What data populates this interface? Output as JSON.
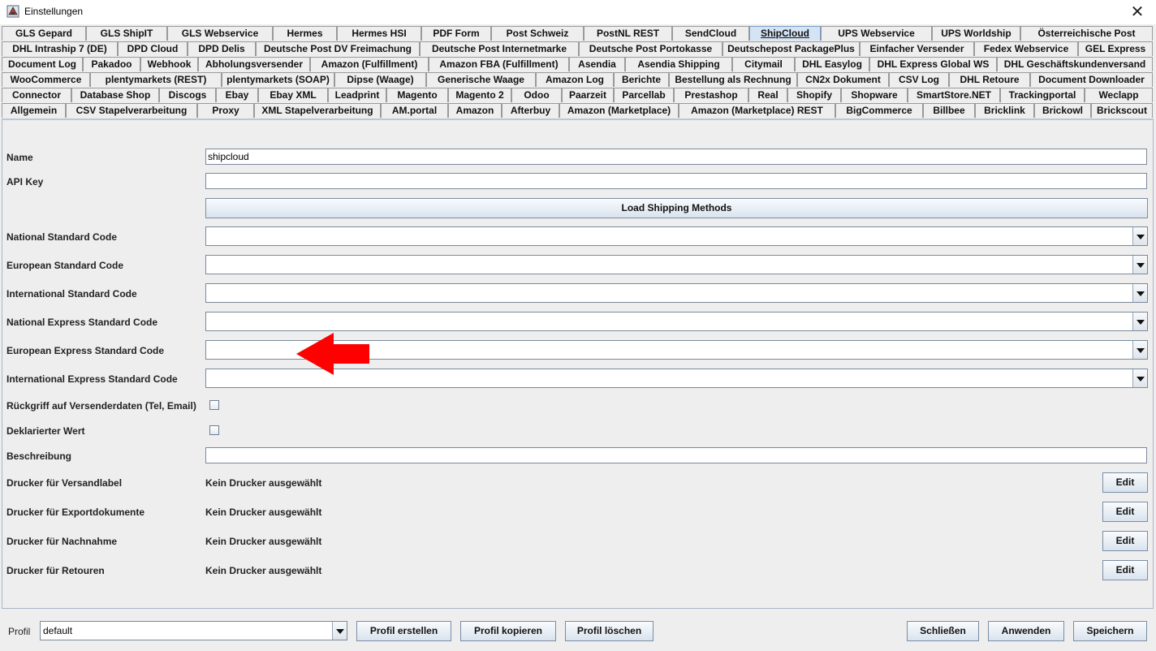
{
  "window": {
    "title": "Einstellungen",
    "close_glyph": "✕"
  },
  "tabs": {
    "row1": [
      "GLS Gepard",
      "GLS ShipIT",
      "GLS Webservice",
      "Hermes",
      "Hermes HSI",
      "PDF Form",
      "Post Schweiz",
      "PostNL REST",
      "SendCloud",
      "ShipCloud",
      "UPS Webservice",
      "UPS Worldship",
      "Österreichische Post"
    ],
    "row2": [
      "DHL Intraship 7 (DE)",
      "DPD Cloud",
      "DPD Delis",
      "Deutsche Post DV Freimachung",
      "Deutsche Post Internetmarke",
      "Deutsche Post Portokasse",
      "Deutschepost PackagePlus",
      "Einfacher Versender",
      "Fedex Webservice",
      "GEL Express"
    ],
    "row3": [
      "Document Log",
      "Pakadoo",
      "Webhook",
      "Abholungsversender",
      "Amazon (Fulfillment)",
      "Amazon FBA (Fulfillment)",
      "Asendia",
      "Asendia Shipping",
      "Citymail",
      "DHL Easylog",
      "DHL Express Global WS",
      "DHL Geschäftskundenversand"
    ],
    "row4": [
      "WooCommerce",
      "plentymarkets (REST)",
      "plentymarkets (SOAP)",
      "Dipse (Waage)",
      "Generische Waage",
      "Amazon Log",
      "Berichte",
      "Bestellung als Rechnung",
      "CN2x Dokument",
      "CSV Log",
      "DHL Retoure",
      "Document Downloader"
    ],
    "row5": [
      "Connector",
      "Database Shop",
      "Discogs",
      "Ebay",
      "Ebay XML",
      "Leadprint",
      "Magento",
      "Magento 2",
      "Odoo",
      "Paarzeit",
      "Parcellab",
      "Prestashop",
      "Real",
      "Shopify",
      "Shopware",
      "SmartStore.NET",
      "Trackingportal",
      "Weclapp"
    ],
    "row6": [
      "Allgemein",
      "CSV Stapelverarbeitung",
      "Proxy",
      "XML Stapelverarbeitung",
      "AM.portal",
      "Amazon",
      "Afterbuy",
      "Amazon (Marketplace)",
      "Amazon (Marketplace) REST",
      "BigCommerce",
      "Billbee",
      "Bricklink",
      "Brickowl",
      "Brickscout"
    ],
    "active": "ShipCloud"
  },
  "form": {
    "name_label": "Name",
    "name_value": "shipcloud",
    "api_key_label": "API Key",
    "api_key_value": "",
    "load_button": "Load Shipping Methods",
    "combos": [
      {
        "label": "National Standard Code",
        "value": ""
      },
      {
        "label": "European Standard Code",
        "value": ""
      },
      {
        "label": "International Standard Code",
        "value": ""
      },
      {
        "label": "National Express Standard Code",
        "value": ""
      },
      {
        "label": "European Express Standard Code",
        "value": ""
      },
      {
        "label": "International Express Standard Code",
        "value": ""
      }
    ],
    "fallback_label": "Rückgriff auf Versenderdaten (Tel, Email)",
    "declared_label": "Deklarierter Wert",
    "description_label": "Beschreibung",
    "description_value": "",
    "printers": [
      {
        "label": "Drucker für Versandlabel",
        "value": "Kein Drucker ausgewählt",
        "button": "Edit"
      },
      {
        "label": "Drucker für Exportdokumente",
        "value": "Kein Drucker ausgewählt",
        "button": "Edit"
      },
      {
        "label": "Drucker für Nachnahme",
        "value": "Kein Drucker ausgewählt",
        "button": "Edit"
      },
      {
        "label": "Drucker für Retouren",
        "value": "Kein Drucker ausgewählt",
        "button": "Edit"
      }
    ]
  },
  "footer": {
    "profile_label": "Profil",
    "profile_value": "default",
    "create": "Profil erstellen",
    "copy": "Profil kopieren",
    "delete": "Profil löschen",
    "close": "Schließen",
    "apply": "Anwenden",
    "save": "Speichern"
  },
  "colors": {
    "annotation_arrow": "#ff0000",
    "active_tab": "#d5e4f5"
  }
}
